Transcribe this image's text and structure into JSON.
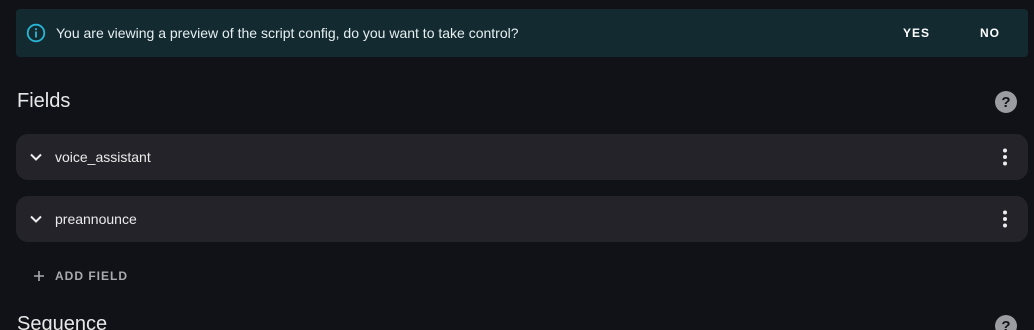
{
  "banner": {
    "message": "You are viewing a preview of the script config, do you want to take control?",
    "yes_label": "YES",
    "no_label": "NO",
    "icon": "info-icon",
    "accent_color": "#29b6d6"
  },
  "fields_section": {
    "title": "Fields",
    "help_icon": "help-icon",
    "items": [
      {
        "label": "voice_assistant",
        "expand_icon": "chevron-down-icon",
        "menu_icon": "more-vertical-icon"
      },
      {
        "label": "preannounce",
        "expand_icon": "chevron-down-icon",
        "menu_icon": "more-vertical-icon"
      }
    ],
    "add_label": "ADD FIELD",
    "add_icon": "plus-icon"
  },
  "sequence_section": {
    "title": "Sequence",
    "help_icon": "help-icon"
  }
}
